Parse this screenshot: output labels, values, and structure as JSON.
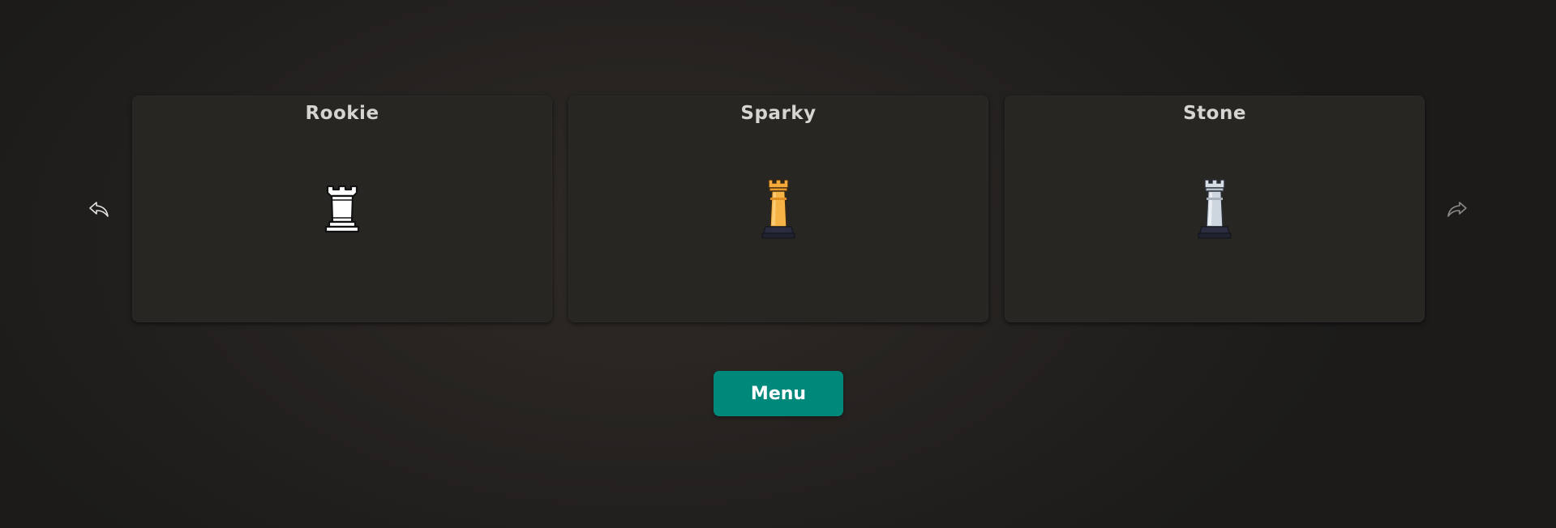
{
  "navigation": {
    "prev_icon": "reply-arrow-left-icon",
    "next_icon": "share-arrow-right-icon"
  },
  "cards": [
    {
      "title": "Rookie",
      "piece_icon": "rook-icon",
      "piece_style": "white-outline",
      "color": "#ffffff"
    },
    {
      "title": "Sparky",
      "piece_icon": "rook-icon",
      "piece_style": "orange",
      "color": "#f5a93a"
    },
    {
      "title": "Stone",
      "piece_icon": "rook-icon",
      "piece_style": "silver",
      "color": "#c9d2dc"
    }
  ],
  "menu": {
    "label": "Menu",
    "color": "#00897b"
  }
}
